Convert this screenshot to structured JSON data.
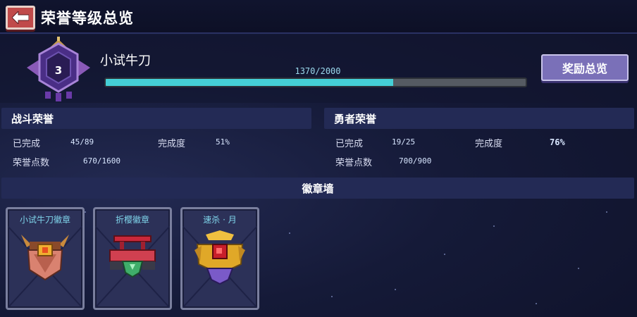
{
  "header": {
    "title": "荣誉等级总览",
    "back_icon": "arrow-left-icon"
  },
  "rank": {
    "level": "3",
    "name": "小试牛刀",
    "xp_text": "1370/2000",
    "xp_current": 1370,
    "xp_max": 2000,
    "reward_button": "奖励总览"
  },
  "battle_honor": {
    "title": "战斗荣誉",
    "completed_label": "已完成",
    "completed_value": "45/89",
    "rate_label": "完成度",
    "rate_value": "51%",
    "points_label": "荣誉点数",
    "points_value": "670/1600"
  },
  "hero_honor": {
    "title": "勇者荣誉",
    "completed_label": "已完成",
    "completed_value": "19/25",
    "rate_label": "完成度",
    "rate_value": "76%",
    "points_label": "荣誉点数",
    "points_value": "700/900"
  },
  "badge_wall": {
    "title": "徽章墙",
    "badges": [
      {
        "name": "小试牛刀徽章",
        "icon": "horned-shield-badge-icon"
      },
      {
        "name": "折樱徽章",
        "icon": "torii-gem-badge-icon"
      },
      {
        "name": "速杀 · 月",
        "icon": "gold-ruby-crest-badge-icon"
      }
    ]
  },
  "colors": {
    "accent_cyan": "#45cfd6",
    "back_button": "#c04a4a",
    "reward_button": "#7a70b8",
    "section_header": "#232a55",
    "badge_title": "#7fd4ea"
  }
}
